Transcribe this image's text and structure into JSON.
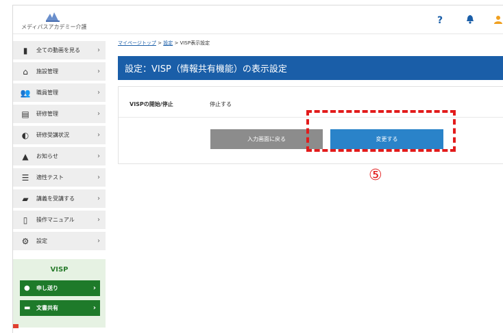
{
  "app": {
    "logo_text": "メディパスアカデミー介護"
  },
  "header": {
    "help_icon": "?",
    "bell_icon": "bell-icon",
    "user_icon": "user-icon"
  },
  "sidebar": {
    "items": [
      {
        "label": "全ての動画を見る",
        "icon": "video-icon",
        "glyph": "▮"
      },
      {
        "label": "施設管理",
        "icon": "house-icon",
        "glyph": "⌂"
      },
      {
        "label": "職員管理",
        "icon": "staff-icon",
        "glyph": "👥"
      },
      {
        "label": "研修管理",
        "icon": "clipboard-icon",
        "glyph": "▤"
      },
      {
        "label": "研修受講状況",
        "icon": "pie-chart-icon",
        "glyph": "◐"
      },
      {
        "label": "お知らせ",
        "icon": "bell-icon",
        "glyph": "▲"
      },
      {
        "label": "適性テスト",
        "icon": "checklist-icon",
        "glyph": "☰"
      },
      {
        "label": "講義を受講する",
        "icon": "graduation-cap-icon",
        "glyph": "▰"
      },
      {
        "label": "操作マニュアル",
        "icon": "document-icon",
        "glyph": "▯"
      },
      {
        "label": "設定",
        "icon": "gear-icon",
        "glyph": "⚙"
      }
    ]
  },
  "visp": {
    "title": "VISP",
    "buttons": [
      {
        "label": "申し送り",
        "icon": "chat-icon",
        "glyph": "●"
      },
      {
        "label": "文書共有",
        "icon": "folder-icon",
        "glyph": "▬"
      }
    ]
  },
  "breadcrumb": {
    "home": "マイページトップ",
    "sep": ">",
    "settings": "設定",
    "current": "VISP表示設定"
  },
  "page": {
    "title": "設定：VISP（情報共有機能）の表示設定"
  },
  "form": {
    "row_label": "VISPの開始/停止",
    "row_value": "停止する",
    "back_button": "入力画面に戻る",
    "change_button": "変更する"
  },
  "annotation": {
    "marker": "⑤",
    "color": "#e21b1b"
  },
  "colors": {
    "accent": "#1a5ea8",
    "visp_green": "#1e7a2a"
  }
}
